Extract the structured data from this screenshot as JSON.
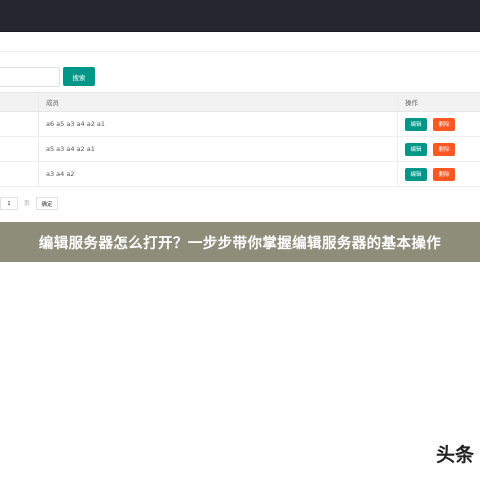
{
  "search": {
    "placeholder": "",
    "button_label": "搜索"
  },
  "table": {
    "headers": [
      "成员",
      "操作"
    ],
    "rows": [
      {
        "members": "a6 a5 a3 a4 a2 a1",
        "edit_label": "编辑",
        "delete_label": "删除"
      },
      {
        "members": "a5 a3 a4 a2 a1",
        "edit_label": "编辑",
        "delete_label": "删除"
      },
      {
        "members": "a3 a4 a2",
        "edit_label": "编辑",
        "delete_label": "删除"
      }
    ]
  },
  "pagination": {
    "current_page": "1",
    "page_unit": "页",
    "confirm_label": "确定"
  },
  "banner": {
    "title": "编辑服务器怎么打开？一步步带你掌握编辑服务器的基本操作"
  },
  "watermark": {
    "text": "头条"
  },
  "colors": {
    "primary": "#009688",
    "danger": "#ff5722",
    "banner": "#8e8d7a",
    "topbar": "#23262e"
  }
}
